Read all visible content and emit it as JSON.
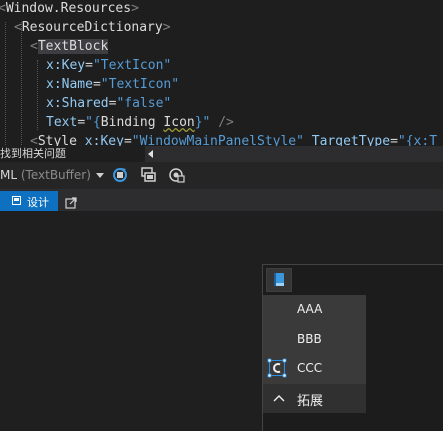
{
  "editor": {
    "lines": [
      [
        [
          "punct",
          "<"
        ],
        [
          "tag",
          "Window.Resources"
        ],
        [
          "punct",
          ">"
        ]
      ],
      [
        [
          "punct",
          "<"
        ],
        [
          "tag",
          "ResourceDictionary"
        ],
        [
          "punct",
          ">"
        ]
      ],
      [
        [
          "punct",
          "<"
        ],
        [
          "taghl",
          "TextBlock"
        ]
      ],
      [
        [
          "prefix",
          "x:"
        ],
        [
          "attr",
          "Key"
        ],
        [
          "plain",
          "="
        ],
        [
          "str",
          "\"TextIcon\""
        ]
      ],
      [
        [
          "prefix",
          "x:"
        ],
        [
          "attr",
          "Name"
        ],
        [
          "plain",
          "="
        ],
        [
          "str",
          "\"TextIcon\""
        ]
      ],
      [
        [
          "prefix",
          "x:"
        ],
        [
          "attr",
          "Shared"
        ],
        [
          "plain",
          "="
        ],
        [
          "str",
          "\"false\""
        ]
      ],
      [
        [
          "attr",
          "Text"
        ],
        [
          "plain",
          "="
        ],
        [
          "str",
          "\"{"
        ],
        [
          "tag",
          "Binding "
        ],
        [
          "warn",
          "Icon"
        ],
        [
          "str",
          "}\""
        ],
        [
          "plain",
          " "
        ],
        [
          "punct",
          "/>"
        ]
      ],
      [
        [
          "punct",
          "<"
        ],
        [
          "tag",
          "Style "
        ],
        [
          "prefix",
          "x:"
        ],
        [
          "attr",
          "Key"
        ],
        [
          "plain",
          "="
        ],
        [
          "str",
          "\"WindowMainPanelStyle\""
        ],
        [
          "plain",
          " "
        ],
        [
          "attr",
          "TargetType"
        ],
        [
          "plain",
          "="
        ],
        [
          "str",
          "\"{x:T"
        ]
      ]
    ]
  },
  "issues_bar": {
    "text": "找到相关问题"
  },
  "toolbar": {
    "xaml_prefix": "ML",
    "xaml_suffix": " (TextBuffer)"
  },
  "tabs": {
    "design_label": "设计"
  },
  "preview": {
    "menu_items": [
      {
        "label": "AAA"
      },
      {
        "label": "BBB"
      },
      {
        "label": "CCC"
      }
    ],
    "expand_label": "拓展"
  },
  "colors": {
    "accent": "#0e70c0",
    "menu_bg": "#3a3a3a",
    "editor_bg": "#1e1e1e"
  }
}
